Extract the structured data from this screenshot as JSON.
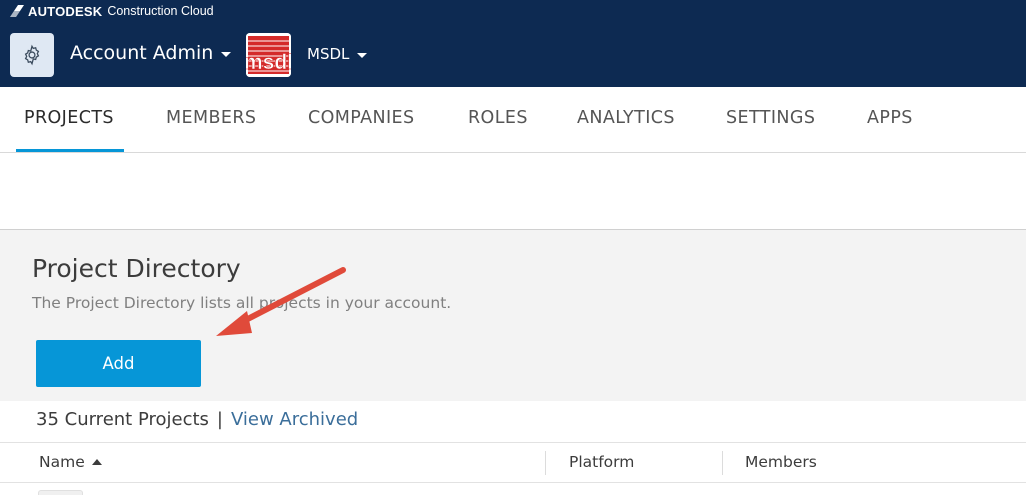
{
  "header": {
    "brand_name": "AUTODESK",
    "brand_product": "Construction Cloud",
    "account_title": "Account Admin",
    "org_name": "MSDL",
    "org_logo_text": "msdl",
    "colors": {
      "topbar": "#0d2a52",
      "gear_button": "#dfe8f3"
    }
  },
  "tabs": [
    {
      "label": "PROJECTS",
      "active": true
    },
    {
      "label": "MEMBERS",
      "active": false
    },
    {
      "label": "COMPANIES",
      "active": false
    },
    {
      "label": "ROLES",
      "active": false
    },
    {
      "label": "ANALYTICS",
      "active": false
    },
    {
      "label": "SETTINGS",
      "active": false
    },
    {
      "label": "APPS",
      "active": false
    }
  ],
  "directory": {
    "title": "Project Directory",
    "subtitle": "The Project Directory lists all projects in your account.",
    "add_label": "Add"
  },
  "projects": {
    "count_label": "35 Current Projects",
    "separator": "|",
    "archived_label": "View Archived"
  },
  "table": {
    "columns": [
      {
        "label": "Name",
        "sort": "ascending"
      },
      {
        "label": "Platform"
      },
      {
        "label": "Members"
      }
    ]
  },
  "annotation": {
    "arrow_color": "#e04a3a"
  },
  "accent_color": "#0696d7"
}
